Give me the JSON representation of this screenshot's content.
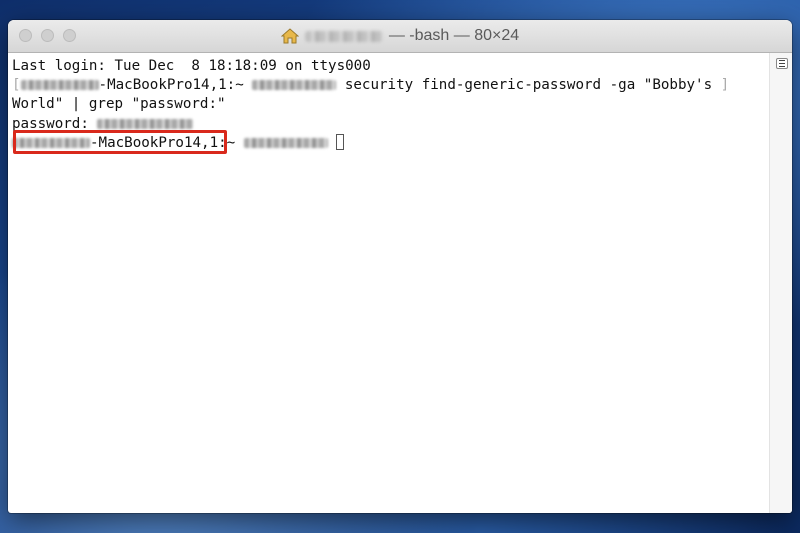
{
  "window": {
    "title": "— -bash — 80×24",
    "buttons": {
      "close": "close",
      "minimize": "minimize",
      "zoom": "zoom"
    }
  },
  "terminal": {
    "line1": "Last login: Tue Dec  8 18:18:09 on ttys000",
    "line2_host": "-MacBookPro14,1:~ ",
    "line2_cmd": " security find-generic-password -ga \"Bobby's ",
    "line3": "World\" | grep \"password:\"",
    "line4_label": "password: ",
    "line5_host": "-MacBookPro14,1:~ "
  },
  "highlight": {
    "color": "#d9291c"
  },
  "icons": [
    "home-icon",
    "scrollbar-marks-icon",
    "text-cursor"
  ]
}
